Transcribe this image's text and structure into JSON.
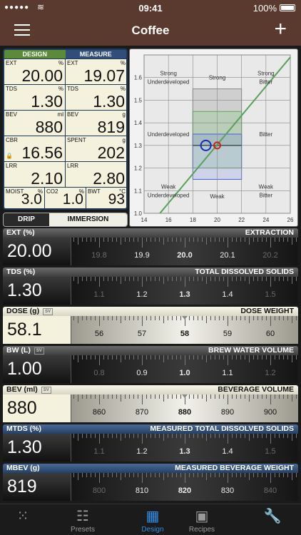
{
  "status": {
    "time": "09:41",
    "battery": "100%"
  },
  "nav": {
    "title": "Coffee"
  },
  "grid": {
    "design_label": "DESIGN",
    "measure_label": "MEASURE",
    "cells": [
      {
        "label": "EXT",
        "unit": "%",
        "value": "20.00"
      },
      {
        "label": "EXT",
        "unit": "%",
        "value": "19.07"
      },
      {
        "label": "TDS",
        "unit": "%",
        "value": "1.30"
      },
      {
        "label": "TDS",
        "unit": "%",
        "value": "1.30"
      },
      {
        "label": "BEV",
        "unit": "ml",
        "value": "880"
      },
      {
        "label": "BEV",
        "unit": "g",
        "value": "819"
      },
      {
        "label": "CBR",
        "unit": "",
        "value": "16.56"
      },
      {
        "label": "SPENT",
        "unit": "g",
        "value": "202"
      },
      {
        "label": "LRR",
        "unit": "",
        "value": "2.10"
      },
      {
        "label": "LRR",
        "unit": "",
        "value": "2.80"
      },
      {
        "label": "MOIST",
        "unit": "%",
        "value": "3.0"
      },
      {
        "label": "CO2",
        "unit": "%",
        "value": "1.0"
      },
      {
        "label": "BWT",
        "unit": "°C",
        "value": "93"
      }
    ]
  },
  "chart_data": {
    "type": "scatter",
    "x_ticks": [
      "14",
      "16",
      "18",
      "20",
      "22",
      "24",
      "26"
    ],
    "y_ticks": [
      "1.0",
      "1.1",
      "1.2",
      "1.3",
      "1.4",
      "1.5",
      "1.6"
    ],
    "xlim": [
      14,
      26
    ],
    "ylim": [
      1.0,
      1.7
    ],
    "grid": true,
    "region_labels": [
      {
        "lines": [
          "Strong",
          "Underdeveloped"
        ],
        "x": 16,
        "y": 1.6
      },
      {
        "lines": [
          "Strong"
        ],
        "x": 20,
        "y": 1.6
      },
      {
        "lines": [
          "Strong",
          "Bitter"
        ],
        "x": 24,
        "y": 1.6
      },
      {
        "lines": [
          "Underdeveloped"
        ],
        "x": 16,
        "y": 1.35
      },
      {
        "lines": [
          "Bitter"
        ],
        "x": 24,
        "y": 1.35
      },
      {
        "lines": [
          "Weak",
          "Underdeveloped"
        ],
        "x": 16,
        "y": 1.1
      },
      {
        "lines": [
          "Weak"
        ],
        "x": 20,
        "y": 1.075
      },
      {
        "lines": [
          "Weak",
          "Bitter"
        ],
        "x": 24,
        "y": 1.1
      }
    ],
    "boxes": [
      {
        "x": [
          18,
          22
        ],
        "y": [
          1.3,
          1.55
        ],
        "color": "#8a8a8a"
      },
      {
        "x": [
          18,
          22
        ],
        "y": [
          1.2,
          1.45
        ],
        "color": "#5aaa5a"
      },
      {
        "x": [
          18,
          22
        ],
        "y": [
          1.15,
          1.35
        ],
        "color": "#4a5ae0"
      }
    ],
    "line": {
      "points": [
        [
          15.3,
          1.0
        ],
        [
          26.0,
          1.69
        ]
      ],
      "color": "#5aa05a"
    },
    "h_line": {
      "x": [
        18,
        22
      ],
      "y": 1.3
    },
    "points": [
      {
        "x": 19.07,
        "y": 1.3,
        "color": "#1a2ab8",
        "name": "measure"
      },
      {
        "x": 20.0,
        "y": 1.3,
        "color": "#cc2222",
        "name": "design"
      }
    ]
  },
  "modes": {
    "drip": "DRIP",
    "immersion": "IMMERSION"
  },
  "rows": [
    {
      "id": "ext",
      "label": "EXT (%)",
      "title": "EXTRACTION",
      "sv": "",
      "value": "20.00",
      "style": "dark",
      "ticks": [
        "19.8",
        "19.9",
        "20.0",
        "20.1",
        "20.2"
      ]
    },
    {
      "id": "tds",
      "label": "TDS (%)",
      "title": "TOTAL DISSOLVED SOLIDS",
      "sv": "",
      "value": "1.30",
      "style": "dark",
      "ticks": [
        "1.1",
        "1.2",
        "1.3",
        "1.4",
        "1.5"
      ]
    },
    {
      "id": "dose",
      "label": "DOSE (g)",
      "title": "DOSE WEIGHT",
      "sv": "SV",
      "value": "58.1",
      "style": "light",
      "ticks": [
        "56",
        "57",
        "58",
        "59",
        "60"
      ]
    },
    {
      "id": "bw",
      "label": "BW (L)",
      "title": "BREW WATER VOLUME",
      "sv": "SV",
      "value": "1.00",
      "style": "dark",
      "ticks": [
        "0.8",
        "0.9",
        "1.0",
        "1.1",
        "1.2"
      ]
    },
    {
      "id": "bev",
      "label": "BEV (ml)",
      "title": "BEVERAGE VOLUME",
      "sv": "SV",
      "value": "880",
      "style": "light",
      "ticks": [
        "860",
        "870",
        "880",
        "890",
        "900"
      ]
    },
    {
      "id": "mtds",
      "label": "MTDS (%)",
      "title": "MEASURED TOTAL DISSOLVED SOLIDS",
      "sv": "",
      "value": "1.30",
      "style": "blue",
      "ticks": [
        "1.1",
        "1.2",
        "1.3",
        "1.4",
        "1.5"
      ]
    },
    {
      "id": "mbev",
      "label": "MBEV (g)",
      "title": "MEASURED BEVERAGE WEIGHT",
      "sv": "",
      "value": "819",
      "style": "blue",
      "ticks": [
        "800",
        "810",
        "820",
        "830",
        "840"
      ]
    }
  ],
  "tabs": [
    {
      "id": "grid",
      "label": "",
      "icon": "grid-icon"
    },
    {
      "id": "presets",
      "label": "Presets",
      "icon": "sliders-icon"
    },
    {
      "id": "design",
      "label": "Design",
      "icon": "calculator-icon"
    },
    {
      "id": "recipes",
      "label": "Recipes",
      "icon": "box-icon"
    },
    {
      "id": "tools",
      "label": "",
      "icon": "wrench-icon"
    }
  ],
  "colors": {
    "nav": "#5a3a2e",
    "design": "#5a8a3a",
    "measure": "#2f4f7a",
    "tab_active": "#2f8de4"
  }
}
